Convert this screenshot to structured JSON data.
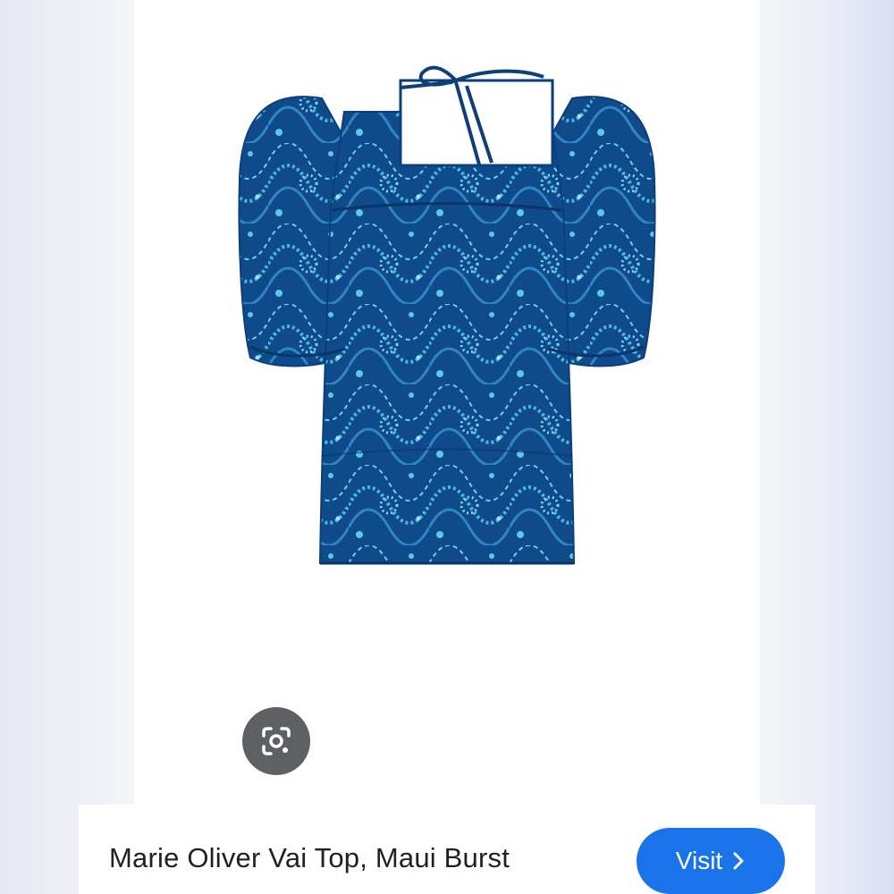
{
  "result": {
    "title": "Marie Oliver Vai Top, Maui Burst",
    "visit_label": "Visit"
  },
  "image": {
    "subject": "blouse-photo",
    "colors": {
      "fabric_dark": "#0b3f7a",
      "fabric_mid": "#1e6fb0",
      "fabric_light": "#5cc7e8",
      "tie": "#0e3f78"
    }
  },
  "icons": {
    "lens": "google-lens-icon",
    "visit_chevron": "chevron-right-icon"
  },
  "colors": {
    "accent": "#1a73e8",
    "lens_bg": "#5f6064",
    "panel_bg": "#ffffff",
    "backdrop": "#eef0f6",
    "title_text": "#202124"
  }
}
